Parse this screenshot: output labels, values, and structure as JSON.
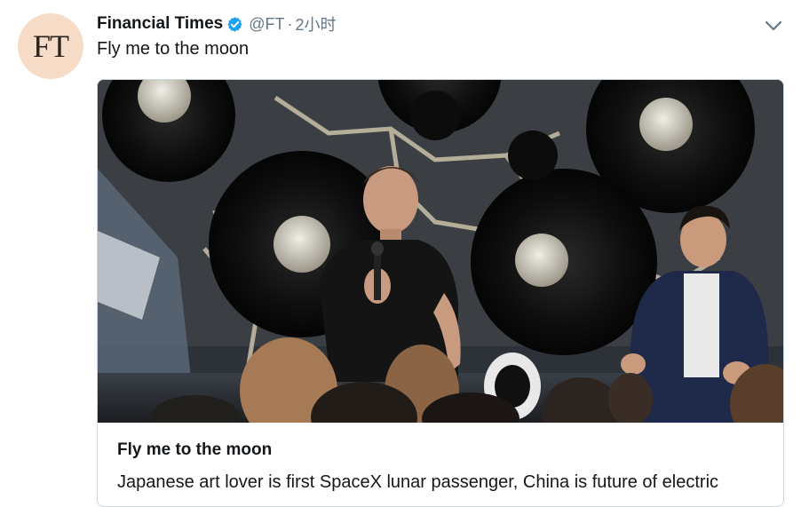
{
  "tweet": {
    "avatar_text": "FT",
    "author_name": "Financial Times",
    "handle": "@FT",
    "separator": "·",
    "timestamp": "2小时",
    "text": "Fly me to the moon",
    "card": {
      "title": "Fly me to the moon",
      "description": "Japanese art lover is first SpaceX lunar passenger, China is future of electric"
    }
  },
  "icons": {
    "verified": "verified-badge-icon",
    "caret": "chevron-down-icon"
  },
  "colors": {
    "avatar_bg": "#f6dcc6",
    "verified": "#1da1f2",
    "secondary_text": "#657786",
    "border": "#ccd6dd"
  }
}
